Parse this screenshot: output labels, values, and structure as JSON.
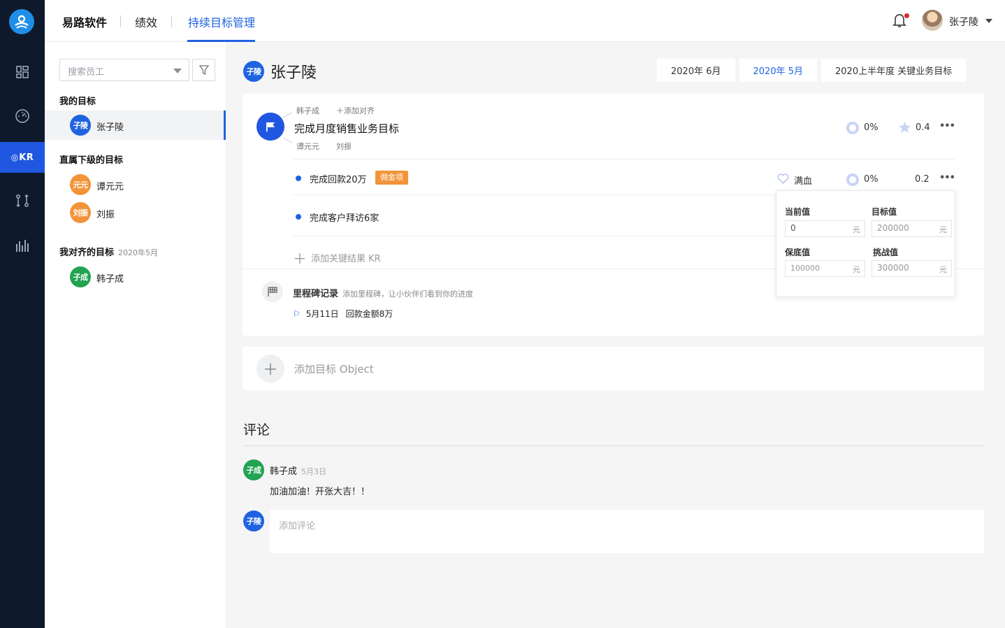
{
  "colors": {
    "accent": "#1f63e0",
    "rail_bg": "#0e1a2b",
    "orange": "#f29439",
    "green": "#22a352"
  },
  "rail": {
    "items": [
      {
        "icon": "dashboard-icon"
      },
      {
        "icon": "speedometer-icon"
      },
      {
        "icon": "okr-icon",
        "label": "KR"
      },
      {
        "icon": "compare-icon"
      },
      {
        "icon": "bar-chart-icon"
      }
    ]
  },
  "topbar": {
    "brand": "易路软件",
    "menu": [
      "绩效",
      "持续目标管理"
    ],
    "active_menu": "持续目标管理",
    "user_name": "张子陵"
  },
  "sidebar": {
    "search_placeholder": "搜索员工",
    "my_goals_title": "我的目标",
    "my_goals": [
      {
        "avatar": "子陵",
        "name": "张子陵"
      }
    ],
    "subordinates_title": "直属下级的目标",
    "subordinates": [
      {
        "avatar": "元元",
        "name": "谭元元"
      },
      {
        "avatar": "刘振",
        "name": "刘振"
      }
    ],
    "aligned_title": "我对齐的目标",
    "aligned_period": "2020年5月",
    "aligned": [
      {
        "avatar": "子成",
        "name": "韩子成"
      }
    ]
  },
  "main": {
    "avatar": "子陵",
    "name": "张子陵",
    "periods": [
      "2020年 6月",
      "2020年 5月",
      "2020上半年度 关键业务目标"
    ],
    "active_period": "2020年 5月",
    "objective": {
      "aligned_up": "韩子成",
      "add_align": "添加对齐",
      "title": "完成月度销售业务目标",
      "aligned_down": [
        "谭元元",
        "刘振"
      ],
      "progress": "0%",
      "score": "0.4"
    },
    "krs": [
      {
        "text": "完成回款20万",
        "tag": "佣金项",
        "status": "满血",
        "progress": "0%",
        "score": "0.2"
      },
      {
        "text": "完成客户拜访6家"
      }
    ],
    "add_kr": "添加关键结果 KR",
    "popover": {
      "current_label": "当前值",
      "current_value": "0",
      "target_label": "目标值",
      "target_value": "200000",
      "floor_label": "保底值",
      "floor_value": "100000",
      "challenge_label": "挑战值",
      "challenge_value": "300000",
      "unit": "元"
    },
    "milestone": {
      "title": "里程碑记录",
      "hint": "添加里程碑，让小伙伴们看到你的进度",
      "date": "5月11日",
      "text": "回款金额8万"
    },
    "add_objective": "添加目标 Object",
    "comments": {
      "title": "评论",
      "items": [
        {
          "avatar": "子成",
          "author": "韩子成",
          "date": "5月3日",
          "body": "加油加油！开张大吉！！"
        }
      ],
      "input_avatar": "子陵",
      "input_placeholder": "添加评论"
    }
  }
}
